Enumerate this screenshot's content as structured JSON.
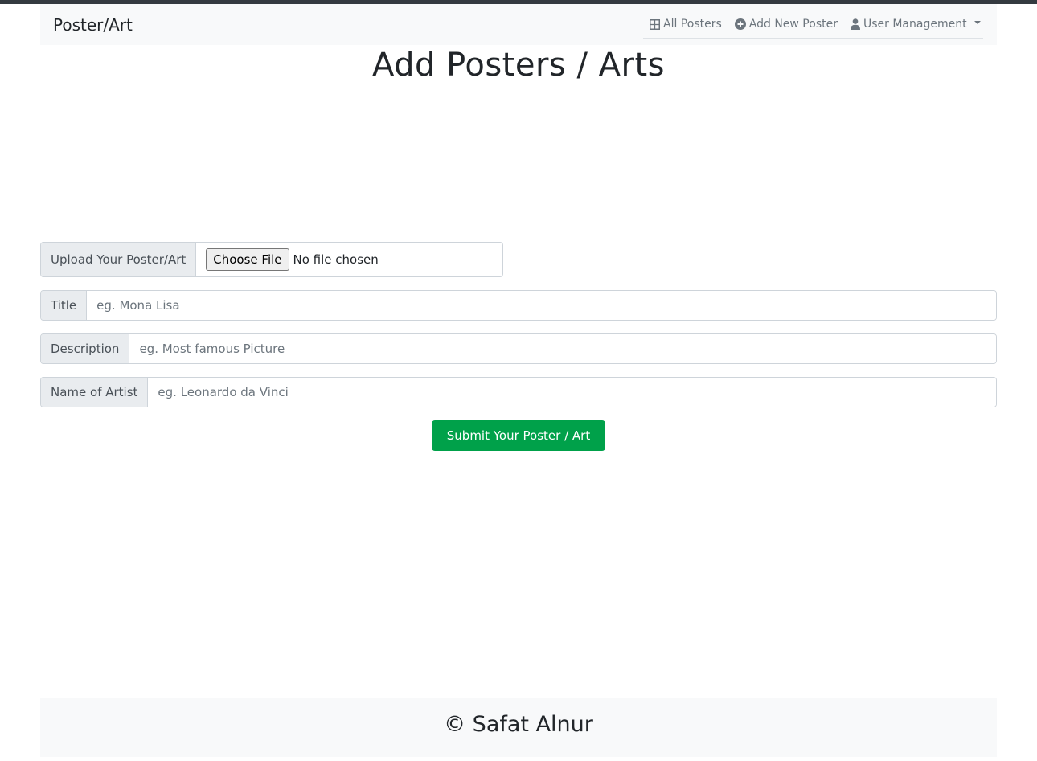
{
  "navbar": {
    "brand": "Poster/Art",
    "links": [
      {
        "label": "All Posters",
        "icon": "grid-icon"
      },
      {
        "label": "Add New Poster",
        "icon": "plus-circle-icon"
      },
      {
        "label": "User Management",
        "icon": "user-icon"
      }
    ]
  },
  "page": {
    "title": "Add Posters / Arts"
  },
  "form": {
    "upload": {
      "label": "Upload Your Poster/Art",
      "button_label": "Choose File",
      "status": "No file chosen"
    },
    "title": {
      "label": "Title",
      "placeholder": "eg. Mona Lisa"
    },
    "description": {
      "label": "Description",
      "placeholder": "eg. Most famous Picture"
    },
    "artist": {
      "label": "Name of Artist",
      "placeholder": "eg. Leonardo da Vinci"
    },
    "submit_label": "Submit Your Poster / Art"
  },
  "footer": {
    "text": "© Safat Alnur"
  },
  "colors": {
    "navbar_bg": "#f8f9fa",
    "submit_bg": "#00a14a",
    "top_strip": "#343a40"
  }
}
